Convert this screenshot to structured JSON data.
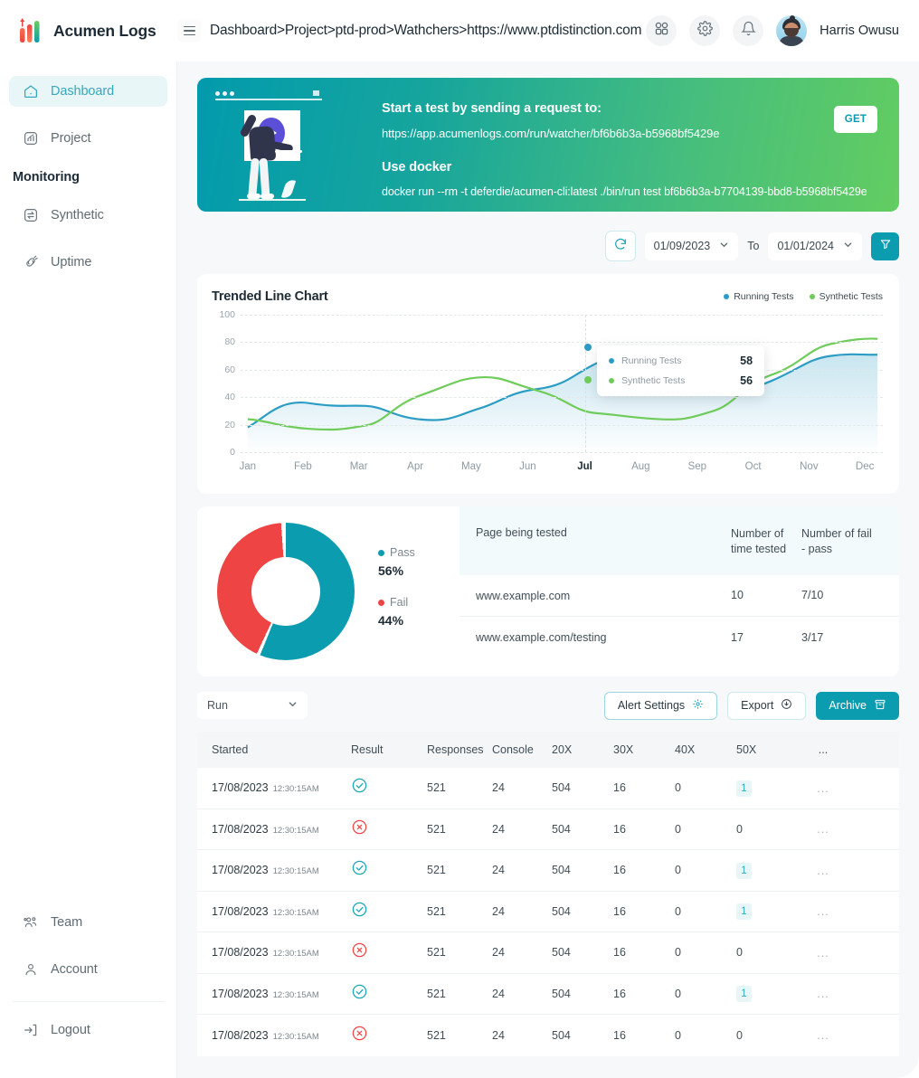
{
  "brand": {
    "name": "Acumen Logs"
  },
  "topbar": {
    "breadcrumb": "Dashboard>Project>ptd-prod>Wathchers>https://www.ptdistinction.com",
    "user_name": "Harris Owusu",
    "icons": {
      "apps": "apps-grid-icon",
      "settings": "gear-icon",
      "notifications": "bell-icon"
    }
  },
  "sidebar": {
    "items": [
      {
        "label": "Dashboard",
        "icon": "home-icon",
        "active": true
      },
      {
        "label": "Project",
        "icon": "chart-square-icon",
        "active": false
      }
    ],
    "section_label": "Monitoring",
    "monitoring": [
      {
        "label": "Synthetic",
        "icon": "sync-square-icon"
      },
      {
        "label": "Uptime",
        "icon": "link-icon"
      }
    ],
    "bottom": [
      {
        "label": "Team",
        "icon": "users-icon"
      },
      {
        "label": "Account",
        "icon": "user-icon"
      },
      {
        "label": "Logout",
        "icon": "logout-icon"
      }
    ]
  },
  "banner": {
    "heading": "Start a test by sending a request to:",
    "url": "https://app.acumenlogs.com/run/watcher/bf6b6b3a-b5968bf5429e",
    "docker_heading": "Use docker",
    "docker_cmd": "docker run --rm -t deferdie/acumen-cli:latest ./bin/run test bf6b6b3a-b7704139-bbd8-b5968bf5429e",
    "get_label": "GET",
    "gradient_from": "#029aad",
    "gradient_to": "#63cd61"
  },
  "date_toolbar": {
    "refresh_icon": "refresh-icon",
    "from": "01/09/2023",
    "to_label": "To",
    "to": "01/01/2024",
    "filter_icon": "filter-icon"
  },
  "chart_data": {
    "type": "line",
    "title": "Trended Line Chart",
    "xlabel": "",
    "ylabel": "",
    "categories": [
      "Jan",
      "Feb",
      "Mar",
      "Apr",
      "May",
      "Jun",
      "Jul",
      "Aug",
      "Sep",
      "Oct",
      "Nov",
      "Dec"
    ],
    "yticks": [
      0,
      20,
      40,
      60,
      80,
      100
    ],
    "ylim": [
      0,
      100
    ],
    "grid": true,
    "legend_position": "top-right",
    "highlight_category": "Jul",
    "series": [
      {
        "name": "Running Tests",
        "color": "#2b9cc4",
        "values": [
          18,
          33,
          35,
          31,
          36,
          46,
          58,
          44,
          44,
          52,
          61,
          63
        ]
      },
      {
        "name": "Synthetic Tests",
        "color": "#6fcc5a",
        "values": [
          24,
          20,
          17,
          31,
          46,
          45,
          33,
          27,
          24,
          33,
          57,
          75
        ]
      }
    ],
    "tooltip": {
      "rows": [
        {
          "name": "Running Tests",
          "value": "58",
          "color": "#2b9cc4"
        },
        {
          "name": "Synthetic Tests",
          "value": "56",
          "color": "#6fcc5a"
        }
      ]
    }
  },
  "donut_chart": {
    "type": "pie",
    "title": "",
    "slices": [
      {
        "label": "Pass",
        "value": 56,
        "display": "56%",
        "color": "#0c9cb0"
      },
      {
        "label": "Fail",
        "value": 44,
        "display": "44%",
        "color": "#ef4444"
      }
    ]
  },
  "pages_table": {
    "columns": [
      "Page being tested",
      "Number of time tested",
      "Number of fail  -  pass"
    ],
    "rows": [
      {
        "page": "www.example.com",
        "tested": "10",
        "fail_pass": "7/10"
      },
      {
        "page": "www.example.com/testing",
        "tested": "17",
        "fail_pass": "3/17"
      }
    ]
  },
  "run_toolbar": {
    "select_value": "Run",
    "alert_settings_label": "Alert Settings",
    "alert_settings_icon": "gear-icon",
    "export_label": "Export",
    "export_icon": "download-icon",
    "archive_label": "Archive",
    "archive_icon": "archive-box-icon"
  },
  "runs_table": {
    "columns": [
      "Started",
      "Result",
      "Responses",
      "Console",
      "20X",
      "30X",
      "40X",
      "50X",
      "..."
    ],
    "rows": [
      {
        "date": "17/08/2023",
        "time": "12:30:15AM",
        "result": "pass",
        "responses": "521",
        "console": "24",
        "x20": "504",
        "x30": "16",
        "x40": "0",
        "x50": "1",
        "more": "..."
      },
      {
        "date": "17/08/2023",
        "time": "12:30:15AM",
        "result": "fail",
        "responses": "521",
        "console": "24",
        "x20": "504",
        "x30": "16",
        "x40": "0",
        "x50": "0",
        "more": "..."
      },
      {
        "date": "17/08/2023",
        "time": "12:30:15AM",
        "result": "pass",
        "responses": "521",
        "console": "24",
        "x20": "504",
        "x30": "16",
        "x40": "0",
        "x50": "1",
        "more": "..."
      },
      {
        "date": "17/08/2023",
        "time": "12:30:15AM",
        "result": "pass",
        "responses": "521",
        "console": "24",
        "x20": "504",
        "x30": "16",
        "x40": "0",
        "x50": "1",
        "more": "..."
      },
      {
        "date": "17/08/2023",
        "time": "12:30:15AM",
        "result": "fail",
        "responses": "521",
        "console": "24",
        "x20": "504",
        "x30": "16",
        "x40": "0",
        "x50": "0",
        "more": "..."
      },
      {
        "date": "17/08/2023",
        "time": "12:30:15AM",
        "result": "pass",
        "responses": "521",
        "console": "24",
        "x20": "504",
        "x30": "16",
        "x40": "0",
        "x50": "1",
        "more": "..."
      },
      {
        "date": "17/08/2023",
        "time": "12:30:15AM",
        "result": "fail",
        "responses": "521",
        "console": "24",
        "x20": "504",
        "x30": "16",
        "x40": "0",
        "x50": "0",
        "more": "..."
      }
    ]
  },
  "colors": {
    "teal": "#0c9cb0",
    "green": "#63cd61",
    "red": "#ef4444",
    "active_bg": "#e9f6f8"
  }
}
